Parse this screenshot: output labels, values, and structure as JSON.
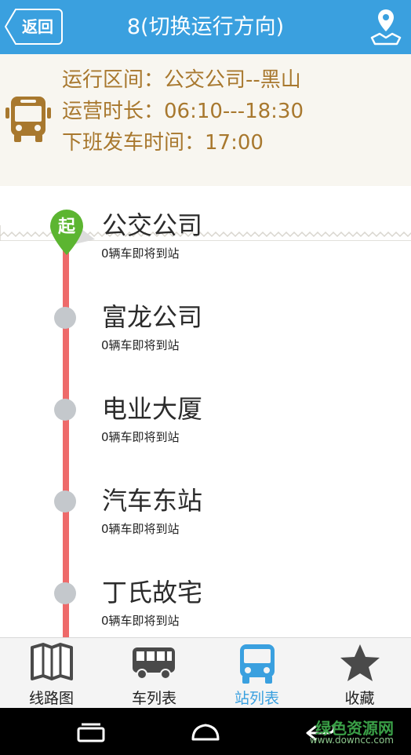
{
  "header": {
    "back_label": "返回",
    "title": "8(切换运行方向)"
  },
  "info": {
    "route_range": "运行区间：公交公司--黑山",
    "operating_hours": "运营时长：06:10---18:30",
    "last_departure": "下班发车时间：17:00"
  },
  "start_marker": "起",
  "stations": [
    {
      "name": "公交公司",
      "status": "0辆车即将到站"
    },
    {
      "name": "富龙公司",
      "status": "0辆车即将到站"
    },
    {
      "name": "电业大厦",
      "status": "0辆车即将到站"
    },
    {
      "name": "汽车东站",
      "status": "0辆车即将到站"
    },
    {
      "name": "丁氏故宅",
      "status": "0辆车即将到站"
    }
  ],
  "tabs": [
    {
      "label": "线路图",
      "icon": "map-book-icon",
      "active": false
    },
    {
      "label": "车列表",
      "icon": "bus-list-icon",
      "active": false
    },
    {
      "label": "站列表",
      "icon": "station-list-icon",
      "active": true
    },
    {
      "label": "收藏",
      "icon": "star-icon",
      "active": false
    }
  ],
  "colors": {
    "header": "#3aa0df",
    "route_line": "#ee6a6a",
    "start_marker": "#5cb531",
    "info_text": "#a8782e"
  },
  "watermark": {
    "text": "绿色资源网",
    "url": "www.downcc.com"
  }
}
